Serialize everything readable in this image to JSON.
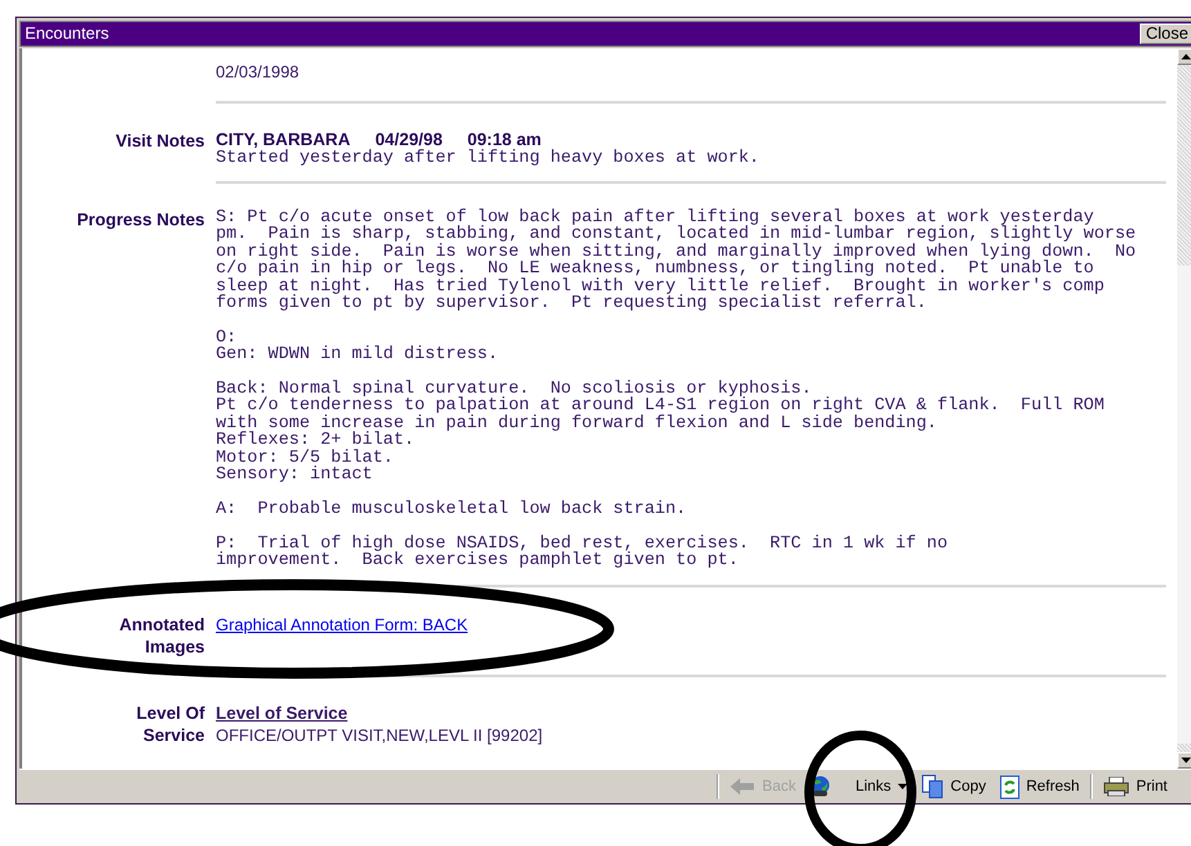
{
  "window": {
    "title": "Encounters",
    "close_button": "Close"
  },
  "sections": [
    {
      "kind": "plain",
      "text": "02/03/1998"
    },
    {
      "kind": "visit",
      "label": [
        "Visit Notes"
      ],
      "header": [
        "CITY, BARBARA",
        "04/29/98",
        "09:18 am"
      ],
      "text": "Started yesterday after lifting heavy boxes at work."
    },
    {
      "kind": "notes",
      "label": [
        "Progress Notes"
      ],
      "text": "S: Pt c/o acute onset of low back pain after lifting several boxes at work yesterday\npm.  Pain is sharp, stabbing, and constant, located in mid-lumbar region, slightly worse\non right side.  Pain is worse when sitting, and marginally improved when lying down.  No\nc/o pain in hip or legs.  No LE weakness, numbness, or tingling noted.  Pt unable to\nsleep at night.  Has tried Tylenol with very little relief.  Brought in worker's comp\nforms given to pt by supervisor.  Pt requesting specialist referral.\n\nO:\nGen: WDWN in mild distress.\n\nBack: Normal spinal curvature.  No scoliosis or kyphosis.\nPt c/o tenderness to palpation at around L4-S1 region on right CVA & flank.  Full ROM\nwith some increase in pain during forward flexion and L side bending.\nReflexes: 2+ bilat.\nMotor: 5/5 bilat.\nSensory: intact\n\nA:  Probable musculoskeletal low back strain.\n\nP:  Trial of high dose NSAIDS, bed rest, exercises.  RTC in 1 wk if no\nimprovement.  Back exercises pamphlet given to pt."
    },
    {
      "kind": "link",
      "label": [
        "Annotated",
        "Images"
      ],
      "link": "Graphical Annotation Form: BACK"
    },
    {
      "kind": "service",
      "label": [
        "Level Of",
        "Service"
      ],
      "link": "Level of Service",
      "text": "OFFICE/OUTPT VISIT,NEW,LEVL II [99202]"
    }
  ],
  "toolbar": [
    {
      "kind": "back",
      "label": "Back",
      "disabled": true
    },
    {
      "kind": "links",
      "label": "Links",
      "disabled": false
    },
    {
      "kind": "copy",
      "label": "Copy",
      "disabled": false
    },
    {
      "kind": "refresh",
      "label": "Refresh",
      "disabled": false
    },
    {
      "kind": "print",
      "label": "Print",
      "disabled": false
    }
  ]
}
